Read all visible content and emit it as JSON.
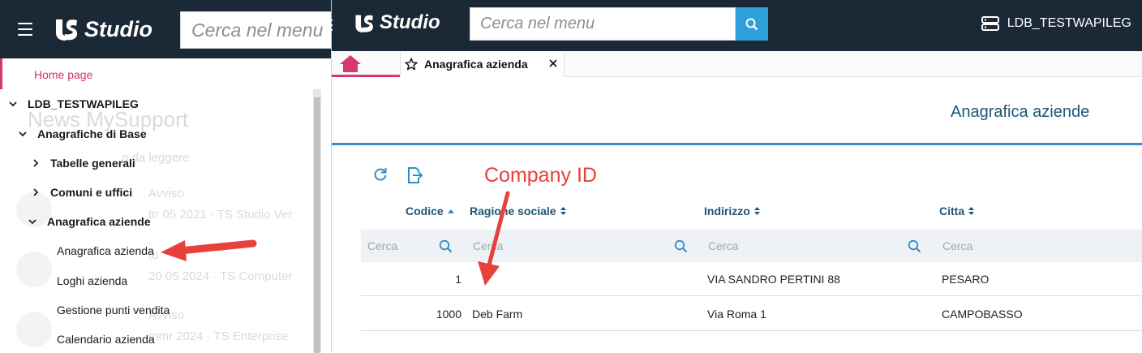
{
  "background_app": {
    "logo": "Studio",
    "search_placeholder": "Cerca nel menu",
    "home_item": "Home page",
    "tree": [
      {
        "label": "LDB_TESTWAPILEG",
        "level": 0,
        "expanded": true
      },
      {
        "label": "Anagrafiche di Base",
        "level": 1,
        "expanded": true
      },
      {
        "label": "Tabelle generali",
        "level": 2,
        "expanded": false
      },
      {
        "label": "Comuni e uffici",
        "level": 2,
        "expanded": false
      },
      {
        "label": "Anagrafica aziende",
        "level": 2,
        "expanded": true
      },
      {
        "label": "Anagrafica azienda",
        "level": 3
      },
      {
        "label": "Loghi azienda",
        "level": 3
      },
      {
        "label": "Gestione punti vendita",
        "level": 3
      },
      {
        "label": "Calendario azienda",
        "level": 3
      }
    ],
    "ghost": {
      "news_title": "News MySupport",
      "news_sub": "n da leggere",
      "n1_label": "Avviso",
      "n1_date": "ttr 05 2021 · TS Studio Ver",
      "n2_label": "to",
      "n2_date": "20 05 2024 · TS Computer",
      "n3_label": "Avviso",
      "n3_date": "mmr 2024 · TS Enterprise"
    }
  },
  "app": {
    "logo": "Studio",
    "search_placeholder": "Cerca nel menu",
    "user": "LDB_TESTWAPILEG",
    "tab_label": "Anagrafica azienda",
    "page_title": "Anagrafica aziende",
    "table": {
      "columns": [
        {
          "label": "Codice",
          "sort": "asc"
        },
        {
          "label": "Ragione sociale",
          "sort": "both"
        },
        {
          "label": "Indirizzo",
          "sort": "both"
        },
        {
          "label": "Citta",
          "sort": "both"
        }
      ],
      "filter_placeholders": [
        "Cerca",
        "Cerca",
        "Cerca",
        "Cerca"
      ],
      "rows": [
        {
          "codice": "1",
          "ragione": "",
          "indirizzo": "VIA SANDRO PERTINI 88",
          "citta": "PESARO"
        },
        {
          "codice": "1000",
          "ragione": "Deb Farm",
          "indirizzo": "Via Roma 1",
          "citta": "CAMPOBASSO"
        }
      ]
    }
  },
  "annotation": {
    "text": "Company ID",
    "color": "#e8403a"
  },
  "colors": {
    "topbar": "#1b2836",
    "accent": "#2d9fd9",
    "home": "#d6396f",
    "header_text": "#1e5478"
  }
}
